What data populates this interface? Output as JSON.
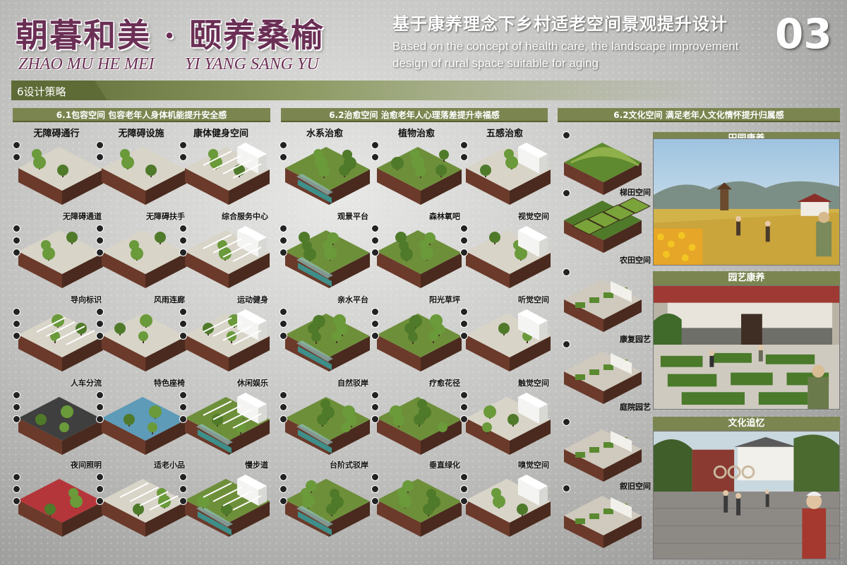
{
  "header": {
    "title_cn": "朝暮和美 · 颐养桑榆",
    "pinyin_left": "ZHAO MU HE MEI",
    "pinyin_right": "YI YANG SANG YU",
    "subtitle_cn": "基于康养理念下乡村适老空间景观提升设计",
    "subtitle_en_1": "Based on the concept of health care, the landscape improvement",
    "subtitle_en_2": "design of rural space suitable for aging",
    "page_number": "03"
  },
  "section": {
    "label": "6设计策略"
  },
  "groups": [
    {
      "label": "6.1包容空间  包容老年人身体机能提升安全感"
    },
    {
      "label": "6.2治愈空间  治愈老年人心理落差提升幸福感"
    },
    {
      "label": "6.2文化空间  满足老年人文化情怀提升归属感"
    }
  ],
  "column_heads": [
    "无障碍通行",
    "无障碍设施",
    "康体健身空间",
    "水系治愈",
    "植物治愈",
    "五感治愈"
  ],
  "block_labels": [
    [
      "",
      "",
      ""
    ],
    [
      "无障碍通道",
      "无障碍扶手",
      "综合服务中心"
    ],
    [
      "导向标识",
      "风雨连廊",
      "运动健身"
    ],
    [
      "人车分流",
      "特色座椅",
      "休闲娱乐"
    ],
    [
      "夜间照明",
      "适老小品",
      "慢步道"
    ],
    [
      "",
      "",
      ""
    ],
    [
      "观景平台",
      "森林氧吧",
      "视觉空间"
    ],
    [
      "亲水平台",
      "阳光草坪",
      "听觉空间"
    ],
    [
      "自然驳岸",
      "疗愈花径",
      "触觉空间"
    ],
    [
      "台阶式驳岸",
      "垂直绿化",
      "嗅觉空间"
    ]
  ],
  "culture_labels": [
    "梯田空间",
    "农田空间",
    "康复园艺",
    "庭院园艺",
    "叙旧空间"
  ],
  "photo_heads": [
    "田园康养",
    "园艺康养",
    "文化追忆"
  ],
  "colors": {
    "title": "#6b2f55",
    "olive": "#7a8550",
    "olive_dark": "#5e6b36",
    "water": "#3e8f8a",
    "soil": "#6b3a2a",
    "grass": "#6e8f3a",
    "tree": "#4f7a2a",
    "paving": "#d8d4c8",
    "red_track": "#b5363a"
  }
}
